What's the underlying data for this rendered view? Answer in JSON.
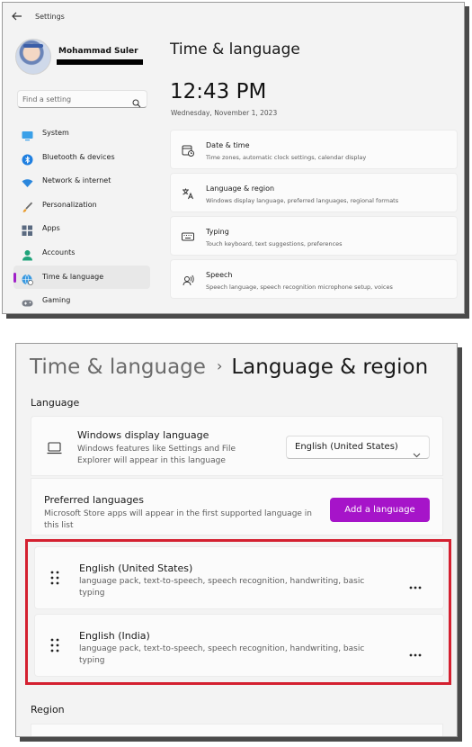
{
  "window1": {
    "app_title": "Settings",
    "user": {
      "name": "Mohammad Suler"
    },
    "search": {
      "placeholder": "Find a setting"
    },
    "nav": [
      {
        "label": "System",
        "icon": "monitor-icon"
      },
      {
        "label": "Bluetooth & devices",
        "icon": "bluetooth-icon"
      },
      {
        "label": "Network & internet",
        "icon": "wifi-icon"
      },
      {
        "label": "Personalization",
        "icon": "brush-icon"
      },
      {
        "label": "Apps",
        "icon": "apps-icon"
      },
      {
        "label": "Accounts",
        "icon": "person-icon"
      },
      {
        "label": "Time & language",
        "icon": "globe-clock-icon",
        "active": true
      },
      {
        "label": "Gaming",
        "icon": "gamepad-icon"
      }
    ],
    "page_title": "Time & language",
    "clock": "12:43 PM",
    "date": "Wednesday, November 1, 2023",
    "cards": [
      {
        "title": "Date & time",
        "subtitle": "Time zones, automatic clock settings, calendar display",
        "icon": "calendar-clock-icon"
      },
      {
        "title": "Language & region",
        "subtitle": "Windows display language, preferred languages, regional formats",
        "icon": "language-icon"
      },
      {
        "title": "Typing",
        "subtitle": "Touch keyboard, text suggestions, preferences",
        "icon": "keyboard-icon"
      },
      {
        "title": "Speech",
        "subtitle": "Speech language, speech recognition microphone setup, voices",
        "icon": "speech-icon"
      }
    ]
  },
  "window2": {
    "breadcrumb": {
      "parent": "Time & language",
      "separator": "›",
      "current": "Language & region"
    },
    "language_section": "Language",
    "display_language": {
      "title": "Windows display language",
      "description": "Windows features like Settings and File Explorer will appear in this language",
      "selected": "English (United States)"
    },
    "preferred": {
      "title": "Preferred languages",
      "description": "Microsoft Store apps will appear in the first supported language in this list",
      "add_button": "Add a language"
    },
    "languages": [
      {
        "name": "English (United States)",
        "features": "language pack, text-to-speech, speech recognition, handwriting, basic typing"
      },
      {
        "name": "English (India)",
        "features": "language pack, text-to-speech, speech recognition, handwriting, basic typing"
      }
    ],
    "region_section": "Region"
  },
  "colors": {
    "accent": "#a614c9",
    "highlight": "#d42030"
  }
}
